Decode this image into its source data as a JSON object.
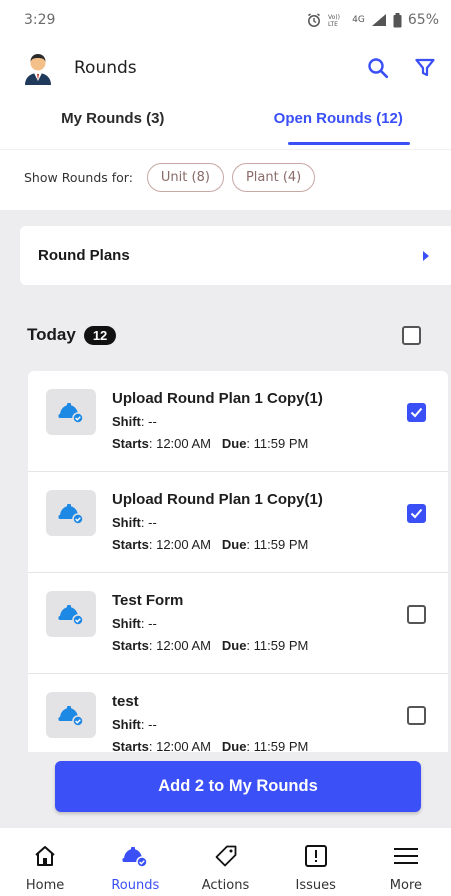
{
  "status_bar": {
    "time": "3:29",
    "network": "4G",
    "battery": "65%"
  },
  "header": {
    "title": "Rounds",
    "search_icon": "search-icon",
    "filter_icon": "filter-icon"
  },
  "tabs": [
    {
      "label": "My Rounds (3)",
      "active": false
    },
    {
      "label": "Open Rounds (12)",
      "active": true
    }
  ],
  "filters": {
    "label": "Show Rounds for:",
    "chips": [
      {
        "label": "Unit (8)"
      },
      {
        "label": "Plant (4)"
      }
    ]
  },
  "round_plans": {
    "label": "Round Plans"
  },
  "today": {
    "label": "Today",
    "count": "12",
    "select_all_checked": false
  },
  "rounds": [
    {
      "title": "Upload Round Plan 1 Copy(1)",
      "shift_label": "Shift",
      "shift": ": --",
      "starts_label": "Starts",
      "starts": ": 12:00 AM",
      "due_label": "Due",
      "due": ": 11:59 PM",
      "checked": true
    },
    {
      "title": "Upload Round Plan 1 Copy(1)",
      "shift_label": "Shift",
      "shift": ": --",
      "starts_label": "Starts",
      "starts": ": 12:00 AM",
      "due_label": "Due",
      "due": ": 11:59 PM",
      "checked": true
    },
    {
      "title": "Test Form",
      "shift_label": "Shift",
      "shift": ": --",
      "starts_label": "Starts",
      "starts": ": 12:00 AM",
      "due_label": "Due",
      "due": ": 11:59 PM",
      "checked": false
    },
    {
      "title": "test",
      "shift_label": "Shift",
      "shift": ": --",
      "starts_label": "Starts",
      "starts": ": 12:00 AM",
      "due_label": "Due",
      "due": ": 11:59 PM",
      "checked": false
    }
  ],
  "add_button": {
    "label": "Add 2 to My Rounds"
  },
  "bottom_nav": [
    {
      "label": "Home",
      "icon": "home-icon",
      "active": false
    },
    {
      "label": "Rounds",
      "icon": "rounds-helmet-icon",
      "active": true
    },
    {
      "label": "Actions",
      "icon": "tag-icon",
      "active": false
    },
    {
      "label": "Issues",
      "icon": "issue-icon",
      "active": false
    },
    {
      "label": "More",
      "icon": "menu-icon",
      "active": false
    }
  ],
  "colors": {
    "accent": "#3a50f6",
    "background": "#ededef"
  }
}
